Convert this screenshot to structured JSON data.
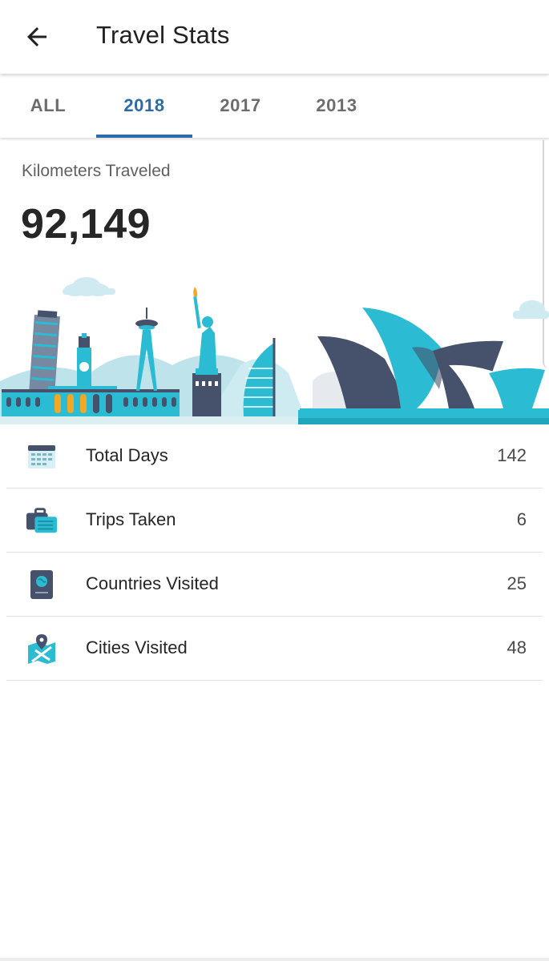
{
  "header": {
    "title": "Travel Stats",
    "back_icon": "arrow-left-icon"
  },
  "tabs": [
    {
      "label": "ALL",
      "active": false
    },
    {
      "label": "2018",
      "active": true
    },
    {
      "label": "2017",
      "active": false
    },
    {
      "label": "2013",
      "active": false
    }
  ],
  "summary": {
    "label": "Kilometers Traveled",
    "value": "92,149"
  },
  "stats": [
    {
      "label": "Total Days",
      "value": "142",
      "icon": "calendar-icon"
    },
    {
      "label": "Trips Taken",
      "value": "6",
      "icon": "suitcase-icon"
    },
    {
      "label": "Countries Visited",
      "value": "25",
      "icon": "passport-icon"
    },
    {
      "label": "Cities Visited",
      "value": "48",
      "icon": "map-pin-icon"
    }
  ],
  "colors": {
    "accent": "#2b6ca8",
    "teal": "#2bbcd4",
    "navy": "#46526b",
    "light_teal": "#b9e3ec"
  }
}
